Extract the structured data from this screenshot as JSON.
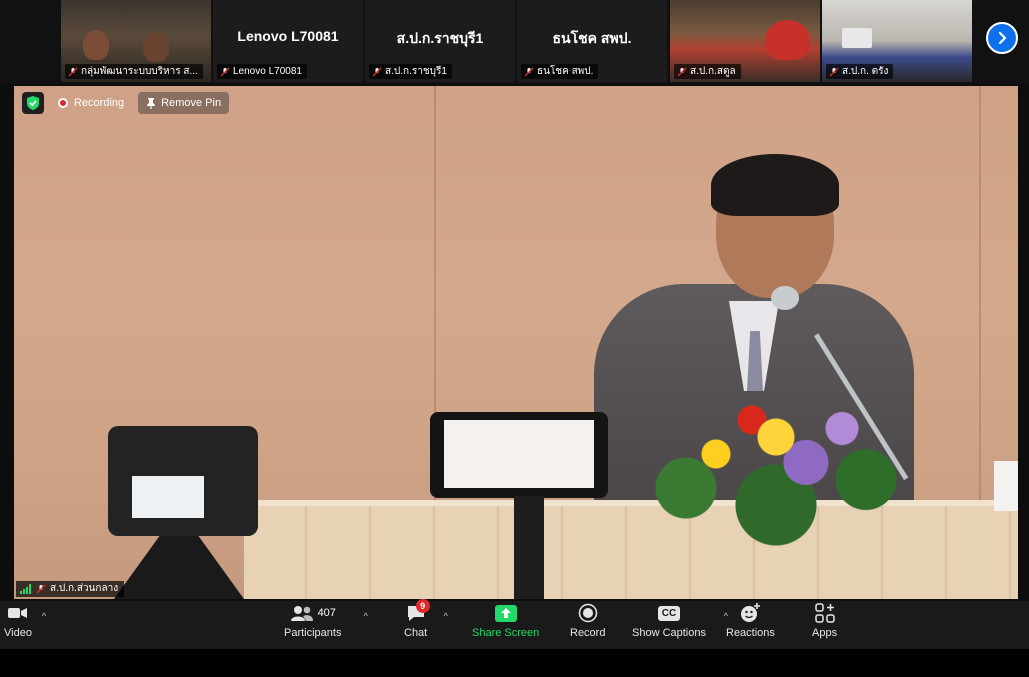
{
  "gallery": {
    "tiles": [
      {
        "label": "กลุ่มพัฒนาระบบบริหาร ส...",
        "center_name": ""
      },
      {
        "label": "Lenovo L70081",
        "center_name": "Lenovo L70081"
      },
      {
        "label": "ส.ป.ก.ราชบุรี1",
        "center_name": "ส.ป.ก.ราชบุรี1"
      },
      {
        "label": "ธนโชค สพป.",
        "center_name": "ธนโชค สพป."
      },
      {
        "label": "ส.ป.ก.สตูล",
        "center_name": ""
      },
      {
        "label": "ส.ป.ก. ตรัง",
        "center_name": ""
      }
    ],
    "next_icon": "chevron-right-icon"
  },
  "main": {
    "recording_label": "Recording",
    "remove_pin_label": "Remove Pin",
    "speaker_label": "ส.ป.ก.ส่วนกลาง"
  },
  "toolbar": {
    "video_label": "Video",
    "participants_label": "Participants",
    "participants_count": "407",
    "chat_label": "Chat",
    "chat_badge": "9",
    "share_label": "Share Screen",
    "record_label": "Record",
    "captions_label": "Show Captions",
    "cc_text": "CC",
    "reactions_label": "Reactions",
    "apps_label": "Apps"
  },
  "colors": {
    "accent_blue": "#0e71eb",
    "share_green": "#23d96a",
    "record_red": "#e02828",
    "toolbar_bg": "#1a1a1a"
  }
}
